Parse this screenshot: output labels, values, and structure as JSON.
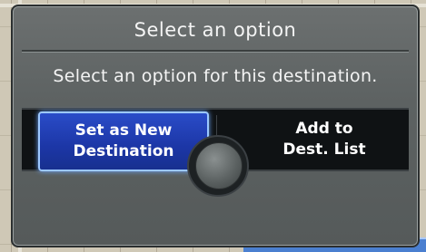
{
  "dialog": {
    "title": "Select an option",
    "message": "Select an option for this destination."
  },
  "options": [
    {
      "line1": "Set as New",
      "line2": "Destination",
      "selected": true
    },
    {
      "line1": "Add to",
      "line2": "Dest. List",
      "selected": false
    }
  ]
}
